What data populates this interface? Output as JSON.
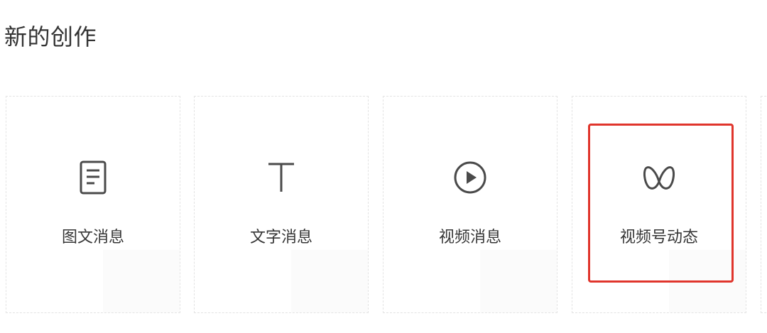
{
  "section": {
    "title": "新的创作"
  },
  "cards": [
    {
      "label": "图文消息",
      "icon": "document-icon"
    },
    {
      "label": "文字消息",
      "icon": "text-t-icon"
    },
    {
      "label": "视频消息",
      "icon": "play-circle-icon"
    },
    {
      "label": "视频号动态",
      "icon": "channels-butterfly-icon"
    }
  ],
  "colors": {
    "icon": "#4a4a4a",
    "label": "#353535",
    "highlight": "#e0352c",
    "card_border": "#e3e3e3"
  }
}
